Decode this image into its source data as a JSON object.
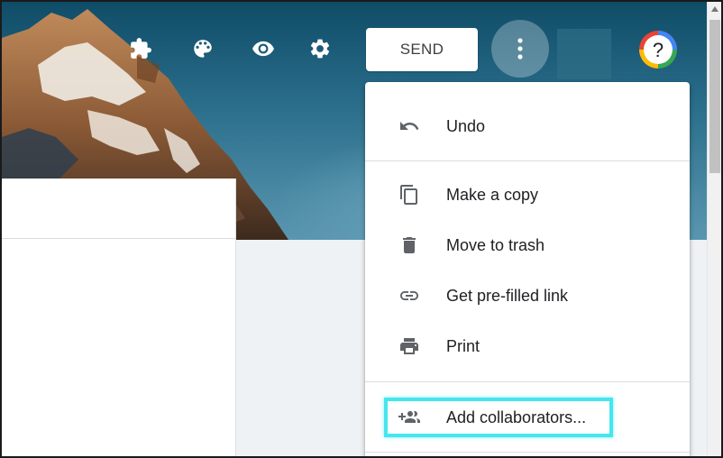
{
  "toolbar": {
    "addons_icon": "puzzle-icon",
    "theme_icon": "palette-icon",
    "preview_icon": "eye-icon",
    "settings_icon": "gear-icon",
    "send_label": "SEND",
    "more_icon": "more-vert-icon",
    "help_label": "?"
  },
  "menu": {
    "items": [
      {
        "label": "Undo",
        "icon": "undo-icon"
      },
      {
        "label": "Make a copy",
        "icon": "copy-icon"
      },
      {
        "label": "Move to trash",
        "icon": "trash-icon"
      },
      {
        "label": "Get pre-filled link",
        "icon": "link-icon"
      },
      {
        "label": "Print",
        "icon": "print-icon"
      },
      {
        "label": "Add collaborators...",
        "icon": "add-people-icon"
      }
    ]
  },
  "colors": {
    "header_accent": "#0f4c67",
    "highlight": "#45e6ee",
    "menu_text": "#202124",
    "menu_icon": "#5f6368"
  }
}
